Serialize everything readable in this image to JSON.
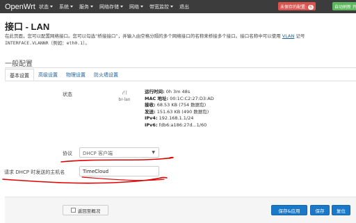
{
  "header": {
    "brand": "OpenWrt",
    "menu": [
      {
        "label": "状态"
      },
      {
        "label": "系统"
      },
      {
        "label": "服务"
      },
      {
        "label": "网络存储"
      },
      {
        "label": "网络"
      },
      {
        "label": "带宽监控"
      },
      {
        "label": "退出"
      }
    ],
    "unsaved_label": "未保存的配置",
    "unsaved_count": "6",
    "refresh_label": "自动刷新 开"
  },
  "page": {
    "title": "接口 - LAN",
    "description_part1": "在此页面，您可以配置网络接口。您可以勾选“桥接接口”，并输入由空格分隔的多个网络接口的名称来桥接多个接口。接口名称中可以使用",
    "description_link": "VLAN",
    "description_part2": "记号",
    "description_line2": "INTERFACE.VLANNR（例如：eth0.1）。"
  },
  "section": {
    "title": "一般配置",
    "tabs": [
      {
        "label": "基本设置",
        "active": true
      },
      {
        "label": "高级设置",
        "active": false
      },
      {
        "label": "物理设置",
        "active": false
      },
      {
        "label": "防火墙设置",
        "active": false
      }
    ]
  },
  "status": {
    "label": "状态",
    "interface_icon": "network-interface-icon",
    "interface_name": "br-lan",
    "rows": [
      {
        "key": "运行时间:",
        "value": "0h 3m 48s"
      },
      {
        "key": "MAC 地址:",
        "value": "00:1C:C2:27:D3:AD"
      },
      {
        "key": "接收:",
        "value": "68.53 KB (754 数据包)"
      },
      {
        "key": "发送:",
        "value": "151.63 KB (490 数据包)"
      },
      {
        "key": "IPv4:",
        "value": "192.168.1.1/24"
      },
      {
        "key": "IPv6:",
        "value": "fdb6:a186:27d...1/60"
      }
    ]
  },
  "form": {
    "protocol_label": "协议",
    "protocol_value": "DHCP 客户端",
    "hostname_label": "请求 DHCP 时发送的主机名",
    "hostname_value": "TimeCloud"
  },
  "footer": {
    "back_label": "返回至概况",
    "save_apply_label": "保存&应用",
    "save_label": "保存",
    "reset_label": "复位"
  },
  "colors": {
    "topbar": "#3c3c3c",
    "link": "#1a5f9e",
    "primary_button": "#1a78c8",
    "annotation_red": "#e00000",
    "unsaved_badge": "#d9534f",
    "refresh_badge": "#5cb85c"
  }
}
